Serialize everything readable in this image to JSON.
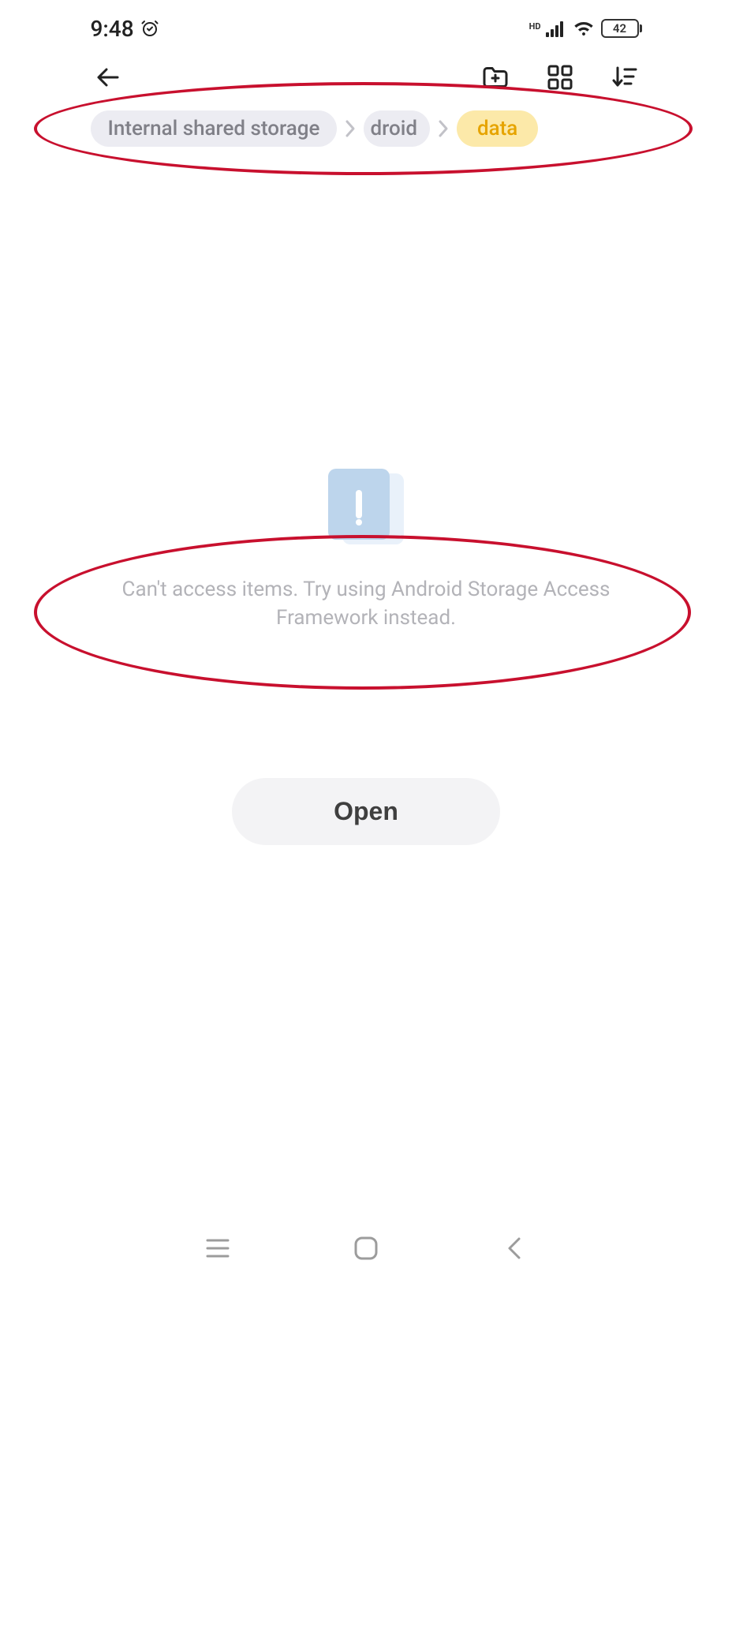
{
  "status": {
    "time": "9:48",
    "battery_pct": "42"
  },
  "breadcrumb": {
    "items": [
      "Internal shared storage",
      "droid",
      "data"
    ]
  },
  "empty_state": {
    "message": "Can't access items. Try using Android Storage Access Framework instead."
  },
  "buttons": {
    "open_label": "Open"
  }
}
